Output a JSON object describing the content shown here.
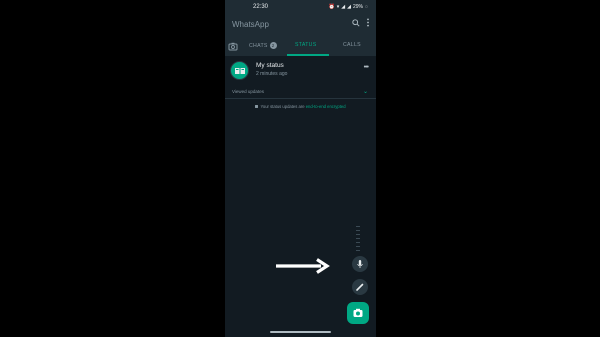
{
  "status_bar": {
    "time": "22:30",
    "battery": "29%"
  },
  "app": {
    "title": "WhatsApp"
  },
  "tabs": {
    "chats_label": "CHATS",
    "chats_badge": "2",
    "status_label": "STATUS",
    "calls_label": "CALLS"
  },
  "my_status": {
    "name": "My status",
    "time": "2 minutes ago"
  },
  "muted": {
    "label": "Viewed updates"
  },
  "encryption": {
    "text": "Your status updates are ",
    "link": "end-to-end encrypted"
  },
  "colors": {
    "accent": "#00a884",
    "background": "#121b22",
    "header": "#1f2c34",
    "text_secondary": "#8696a0"
  },
  "icons": {
    "search": "search-icon",
    "menu": "more-vert-icon",
    "camera": "camera-icon",
    "mic": "mic-icon",
    "pencil": "pencil-icon",
    "arrow": "arrow-right-icon"
  }
}
